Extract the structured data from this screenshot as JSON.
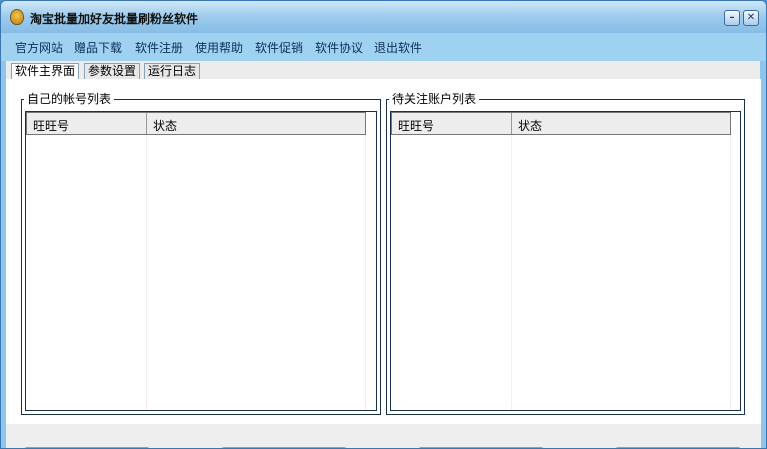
{
  "window": {
    "title": "淘宝批量加好友批量刷粉丝软件",
    "minimize": "–",
    "close": "✕"
  },
  "menu": [
    "官方网站",
    "赠品下载",
    "软件注册",
    "使用帮助",
    "软件促销",
    "软件协议",
    "退出软件"
  ],
  "tabs": [
    "软件主界面",
    "参数设置",
    "运行日志"
  ],
  "left_group": {
    "title": "自己的帐号列表",
    "columns": [
      "旺旺号",
      "状态"
    ]
  },
  "right_group": {
    "title": "待关注账户列表",
    "columns": [
      "旺旺号",
      "状态"
    ]
  }
}
